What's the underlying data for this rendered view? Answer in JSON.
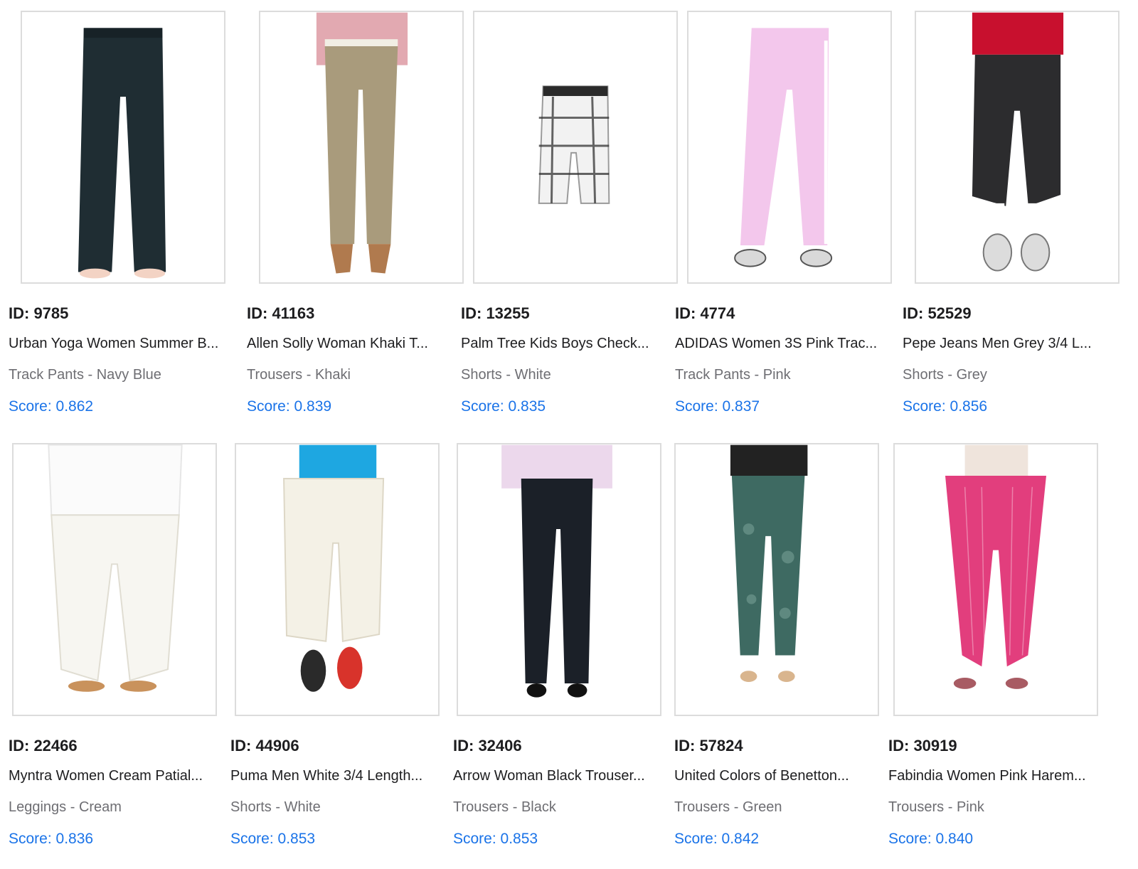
{
  "products": [
    {
      "id_text": "ID: 9785",
      "title": "Urban Yoga Women Summer B...",
      "meta": "Track Pants - Navy Blue",
      "score": "Score: 0.862",
      "image": "navy-track-pants-image",
      "garment_color": "#1f2d33",
      "accent_color": "#f3d3c4"
    },
    {
      "id_text": "ID: 41163",
      "title": "Allen Solly Woman Khaki T...",
      "meta": "Trousers - Khaki",
      "score": "Score: 0.839",
      "image": "khaki-trousers-image",
      "garment_color": "#a99b7c",
      "accent_color": "#e2a9b1"
    },
    {
      "id_text": "ID: 13255",
      "title": "Palm Tree Kids Boys Check...",
      "meta": "Shorts - White",
      "score": "Score: 0.835",
      "image": "check-shorts-image",
      "garment_color": "#f2f2f2",
      "accent_color": "#333333"
    },
    {
      "id_text": "ID: 4774",
      "title": "ADIDAS Women 3S Pink Trac...",
      "meta": "Track Pants - Pink",
      "score": "Score: 0.837",
      "image": "pink-track-pants-image",
      "garment_color": "#f3c7ec",
      "accent_color": "#ffffff"
    },
    {
      "id_text": "ID: 52529",
      "title": "Pepe Jeans Men Grey 3/4 L...",
      "meta": "Shorts - Grey",
      "score": "Score: 0.856",
      "image": "grey-capri-jeans-image",
      "garment_color": "#2c2c2e",
      "accent_color": "#c8102e"
    },
    {
      "id_text": "ID: 22466",
      "title": "Myntra Women Cream Patial...",
      "meta": "Leggings - Cream",
      "score": "Score: 0.836",
      "image": "cream-patiala-image",
      "garment_color": "#f7f6f1",
      "accent_color": "#f7f6f1"
    },
    {
      "id_text": "ID: 44906",
      "title": "Puma Men White 3/4 Length...",
      "meta": "Shorts - White",
      "score": "Score: 0.853",
      "image": "white-capri-shorts-image",
      "garment_color": "#f4f1e6",
      "accent_color": "#1ea7e1"
    },
    {
      "id_text": "ID: 32406",
      "title": "Arrow Woman Black Trouser...",
      "meta": "Trousers - Black",
      "score": "Score: 0.853",
      "image": "black-trousers-image",
      "garment_color": "#1b2028",
      "accent_color": "#ecd8ec"
    },
    {
      "id_text": "ID: 57824",
      "title": "United Colors of Benetton...",
      "meta": "Trousers - Green",
      "score": "Score: 0.842",
      "image": "green-print-trousers-image",
      "garment_color": "#3e6a62",
      "accent_color": "#222222"
    },
    {
      "id_text": "ID: 30919",
      "title": "Fabindia Women Pink Harem...",
      "meta": "Trousers - Pink",
      "score": "Score: 0.840",
      "image": "pink-harem-pants-image",
      "garment_color": "#e23e7d",
      "accent_color": "#efe4dc"
    }
  ],
  "colors": {
    "id_text": "#1d1d1f",
    "meta_text": "#6e6e73",
    "score_text": "#1a73e8",
    "image_border": "#dcdcdc"
  }
}
